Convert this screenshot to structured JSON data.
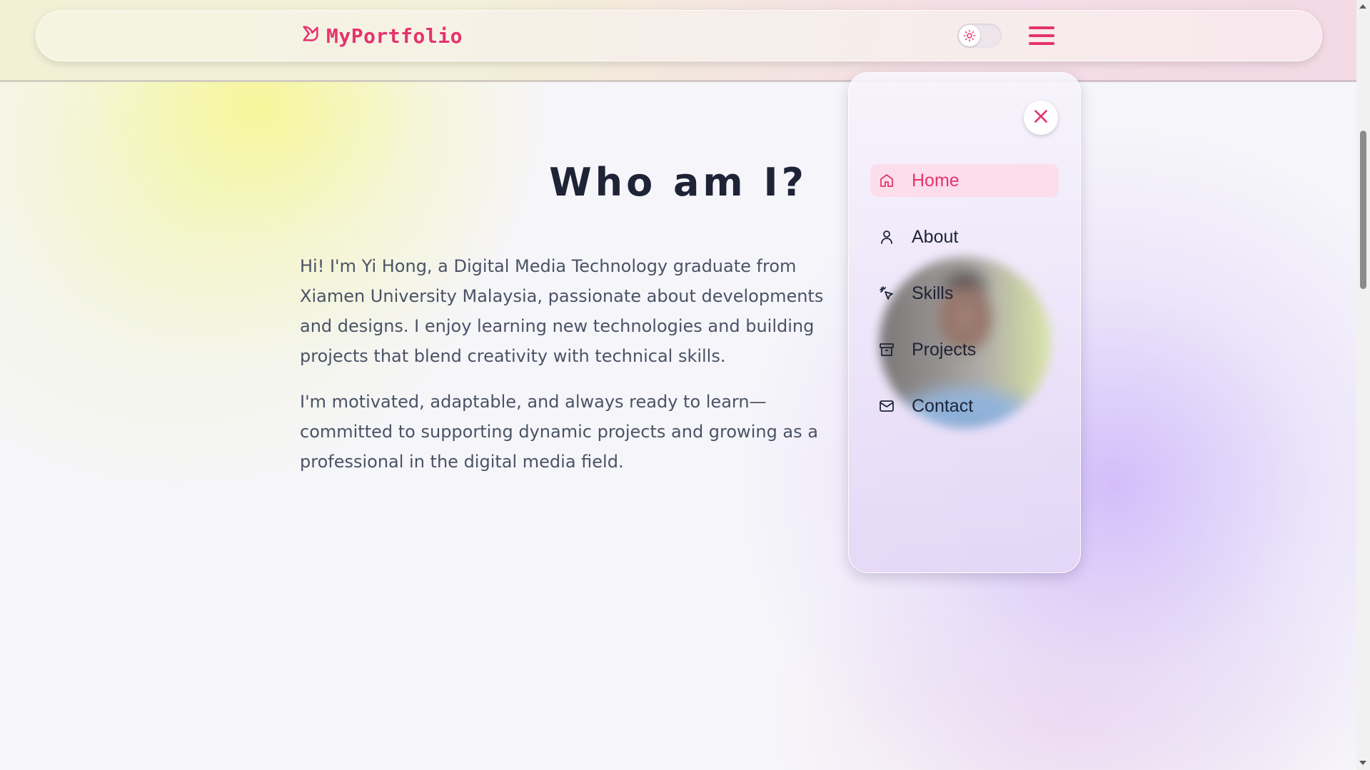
{
  "brand": {
    "name": "MyPortfolio",
    "icon": "bird-logo-icon"
  },
  "header": {
    "theme_toggle_icon": "sun-icon",
    "menu_icon": "hamburger-menu-icon"
  },
  "about": {
    "title": "Who am I?",
    "paragraphs": [
      "Hi! I'm Yi Hong, a Digital Media Technology graduate from Xiamen University Malaysia, passionate about developments and designs. I enjoy learning new technologies and building projects that blend creativity with technical skills.",
      "I'm motivated, adaptable, and always ready to learn—committed to supporting dynamic projects and growing as a professional in the digital media field."
    ]
  },
  "menu": {
    "close_icon": "close-icon",
    "items": [
      {
        "label": "Home",
        "icon": "home-icon",
        "active": true
      },
      {
        "label": "About",
        "icon": "user-icon",
        "active": false
      },
      {
        "label": "Skills",
        "icon": "cursor-click-icon",
        "active": false
      },
      {
        "label": "Projects",
        "icon": "archive-icon",
        "active": false
      },
      {
        "label": "Contact",
        "icon": "mail-icon",
        "active": false
      }
    ]
  },
  "colors": {
    "accent": "#e5336e",
    "text_dark": "#1e2436",
    "text_body": "#4a5365",
    "active_bg": "#fcdcea"
  }
}
